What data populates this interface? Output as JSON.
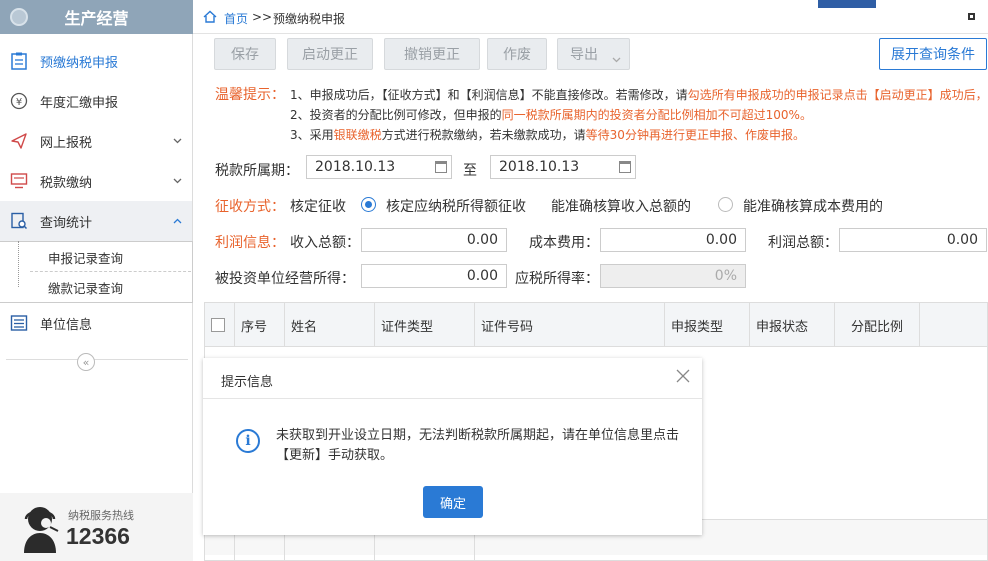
{
  "sidebar": {
    "title": "生产经营",
    "items": [
      {
        "label": "预缴纳税申报"
      },
      {
        "label": "年度汇缴申报"
      },
      {
        "label": "网上报税"
      },
      {
        "label": "税款缴纳"
      },
      {
        "label": "查询统计"
      },
      {
        "label": "单位信息"
      }
    ],
    "subitems": [
      {
        "label": "申报记录查询"
      },
      {
        "label": "缴款记录查询"
      }
    ],
    "collapse": "«",
    "hotline_label": "纳税服务热线",
    "hotline_number": "12366"
  },
  "breadcrumb": {
    "home": "首页",
    "sep": ">>",
    "current": "预缴纳税申报"
  },
  "toolbar": {
    "save": "保存",
    "start_correction": "启动更正",
    "cancel_correction": "撤销更正",
    "void": "作废",
    "export": "导出",
    "expand_query": "展开查询条件"
  },
  "tips": {
    "title": "温馨提示：",
    "l1a": "1、申报成功后，【征收方式】和【利润信息】不能直接修改。若需修改，请",
    "l1b": "勾选所有申报成功的申报记录点击【启动更正】成功后，",
    "l2a": "2、投资者的分配比例可修改，但申报的",
    "l2b": "同一税款所属期内的投资者分配比例相加不可超过100%。",
    "l3a": "3、采用",
    "l3b": "银联缴税",
    "l3c": "方式进行税款缴纳，若未缴款成功，请",
    "l3d": "等待30分钟再进行更正申报、作废申报。"
  },
  "form": {
    "period_label": "税款所属期：",
    "period_from": "2018.10.13",
    "period_to_label": "至",
    "period_to": "2018.10.13",
    "levy_label": "征收方式：",
    "levy_value": "核定征收",
    "radio1": "核定应纳税所得额征收",
    "radio1_selected": true,
    "radio2": "能准确核算收入总额的",
    "radio3": "能准确核算成本费用的",
    "profit_label": "利润信息：",
    "income_label": "收入总额：",
    "income_value": "0.00",
    "cost_label": "成本费用：",
    "cost_value": "0.00",
    "profit_total_label": "利润总额：",
    "profit_total_value": "0.00",
    "invested_label": "被投资单位经营所得：",
    "invested_value": "0.00",
    "rate_label": "应税所得率：",
    "rate_value": "0%"
  },
  "table": {
    "headers": [
      "序号",
      "姓名",
      "证件类型",
      "证件号码",
      "申报类型",
      "申报状态",
      "分配比例"
    ]
  },
  "dialog": {
    "title": "提示信息",
    "message": "未获取到开业设立日期，无法判断税款所属期起，请在单位信息里点击【更新】手动获取。",
    "ok": "确定"
  },
  "colors": {
    "accent": "#2a7ad5",
    "orange": "#e8632d",
    "header": "#8fa5b8"
  }
}
